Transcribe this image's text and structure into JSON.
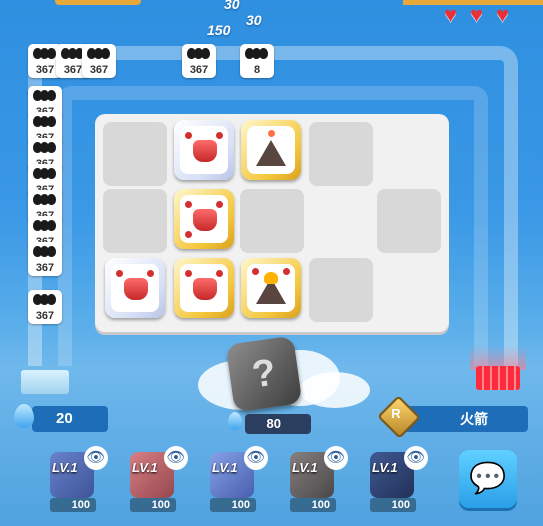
{
  "hud": {
    "lives": 3,
    "floating_numbers": [
      "30",
      "30",
      "150"
    ],
    "heart_icon": "heart-icon"
  },
  "enemies": [
    {
      "hp": "367"
    },
    {
      "hp": "367"
    },
    {
      "hp": "367"
    },
    {
      "hp": "367"
    },
    {
      "hp": "367"
    },
    {
      "hp": "367"
    },
    {
      "hp": "367"
    },
    {
      "hp": "367"
    },
    {
      "hp": "367"
    },
    {
      "hp": "367"
    },
    {
      "hp": "367"
    },
    {
      "hp": "367"
    },
    {
      "hp": "8"
    }
  ],
  "player": {
    "sp": "20",
    "summon_cost": "80",
    "rank_name": "火箭",
    "rank_letter": "R"
  },
  "deck": [
    {
      "level": "LV.1",
      "cost": "100"
    },
    {
      "level": "LV.1",
      "cost": "100"
    },
    {
      "level": "LV.1",
      "cost": "100"
    },
    {
      "level": "LV.1",
      "cost": "100"
    },
    {
      "level": "LV.1",
      "cost": "100"
    }
  ],
  "icons": {
    "summon_dice": "dice-icon",
    "chat": "chat-icon",
    "eye": "eye-icon",
    "sp": "water-drop-icon"
  },
  "colors": {
    "sky": "#3a98e6",
    "board": "#f1f1f1",
    "slot": "#d8d8d8",
    "panel": "#1e6db8",
    "gold_card": "#f4c63a",
    "heart": "#e8303a"
  }
}
